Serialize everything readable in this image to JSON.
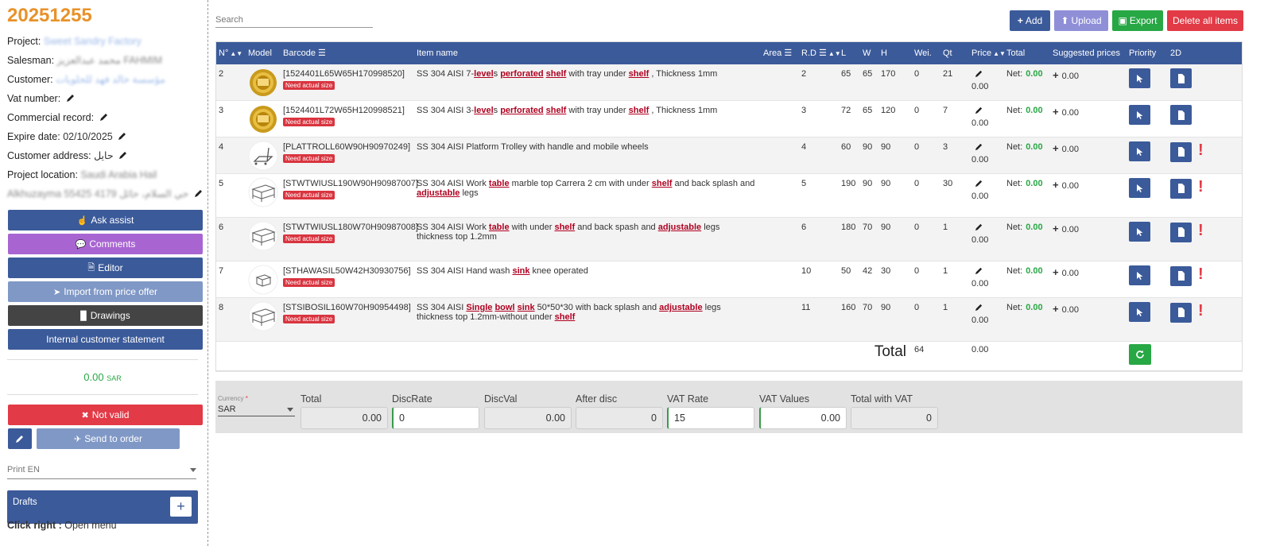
{
  "quote_number": "20251255",
  "info": {
    "project_label": "Project:",
    "project_value": "Sweet Sandry Factory",
    "salesman_label": "Salesman:",
    "salesman_value": "محمد عبدالعزيز FAHMIM",
    "customer_label": "Customer:",
    "customer_value": "مؤسسة خالد فهد للحلويات",
    "vat_label": "Vat number:",
    "commercial_label": "Commercial record:",
    "expire_label": "Expire date:",
    "expire_value": "02/10/2025",
    "address_label": "Customer address:",
    "address_value": "حايل",
    "location_label": "Project location:",
    "location_value": "Saudi Arabia Hail",
    "location_value_2": "Alkhuzayma 55425 4179 حي السلام، حائل"
  },
  "buttons": {
    "ask_assist": "Ask assist",
    "comments": "Comments",
    "editor": "Editor",
    "import_offer": "Import from price offer",
    "drawings": "Drawings",
    "internal_statement": "Internal customer statement",
    "not_valid": "Not valid",
    "send_to_order": "Send to order"
  },
  "amount": {
    "value": "0.00",
    "currency": "SAR"
  },
  "print_select": "Print EN",
  "drafts_label": "Drafts",
  "footer": {
    "bold": "Click right :",
    "text": " Open menu"
  },
  "toolbar": {
    "search_placeholder": "Search",
    "add": "Add",
    "upload": "Upload",
    "export": "Export",
    "delete_all": "Delete all items"
  },
  "columns": [
    "N°",
    "Model",
    "Barcode",
    "Item name",
    "Area",
    "R.D",
    "L",
    "W",
    "H",
    "Wei.",
    "Qt",
    "Price",
    "Total",
    "Suggested prices",
    "Priority",
    "2D"
  ],
  "rows": [
    {
      "n": "2",
      "barcode": "[1524401L65W65H170998520]",
      "need": "Need actual size",
      "name": [
        {
          "t": "SS 304 AISI 7-"
        },
        {
          "t": "level",
          "k": 1
        },
        {
          "t": "s "
        },
        {
          "t": "perforated",
          "k": 1
        },
        {
          "t": " "
        },
        {
          "t": "shelf",
          "k": 1
        },
        {
          "t": " with tray under "
        },
        {
          "t": "shelf",
          "k": 1
        },
        {
          "t": " , Thickness 1mm"
        }
      ],
      "rd": "2",
      "l": "65",
      "w": "65",
      "h": "170",
      "wei": "0",
      "qt": "21",
      "price": "0.00",
      "net_label": "Net:",
      "net": "0.00",
      "suggested": "0.00",
      "warn": false,
      "model": "medal"
    },
    {
      "n": "3",
      "barcode": "[1524401L72W65H120998521]",
      "need": "Need actual size",
      "name": [
        {
          "t": "SS 304 AISI 3-"
        },
        {
          "t": "level",
          "k": 1
        },
        {
          "t": "s "
        },
        {
          "t": "perforated",
          "k": 1
        },
        {
          "t": " "
        },
        {
          "t": "shelf",
          "k": 1
        },
        {
          "t": " with tray under "
        },
        {
          "t": "shelf",
          "k": 1
        },
        {
          "t": " , Thickness 1mm"
        }
      ],
      "rd": "3",
      "l": "72",
      "w": "65",
      "h": "120",
      "wei": "0",
      "qt": "7",
      "price": "0.00",
      "net_label": "Net:",
      "net": "0.00",
      "suggested": "0.00",
      "warn": false,
      "model": "medal"
    },
    {
      "n": "4",
      "barcode": "[PLATTROLL60W90H90970249]",
      "need": "Need actual size",
      "name": [
        {
          "t": "SS 304 AISI Platform Trolley with handle and mobile wheels"
        }
      ],
      "rd": "4",
      "l": "60",
      "w": "90",
      "h": "90",
      "wei": "0",
      "qt": "3",
      "price": "0.00",
      "net_label": "Net:",
      "net": "0.00",
      "suggested": "0.00",
      "warn": true,
      "model": "trolley"
    },
    {
      "n": "5",
      "barcode": "[STWTWIUSL190W90H90987007]",
      "need": "Need actual size",
      "name": [
        {
          "t": "SS 304 AISI Work "
        },
        {
          "t": "table",
          "k": 1
        },
        {
          "t": " marble top Carrera 2 cm with under "
        },
        {
          "t": "shelf",
          "k": 1
        },
        {
          "t": " and back splash and "
        },
        {
          "t": "adjustable",
          "k": 1
        },
        {
          "t": " legs"
        }
      ],
      "rd": "5",
      "l": "190",
      "w": "90",
      "h": "90",
      "wei": "0",
      "qt": "30",
      "price": "0.00",
      "net_label": "Net:",
      "net": "0.00",
      "suggested": "0.00",
      "warn": true,
      "model": "table"
    },
    {
      "n": "6",
      "barcode": "[STWTWIUSL180W70H90987008]",
      "need": "Need actual size",
      "name": [
        {
          "t": "SS 304 AISI Work "
        },
        {
          "t": "table",
          "k": 1
        },
        {
          "t": " with under "
        },
        {
          "t": "shelf",
          "k": 1
        },
        {
          "t": " and back spash and "
        },
        {
          "t": "adjustable",
          "k": 1
        },
        {
          "t": " legs thickness top 1.2mm"
        }
      ],
      "rd": "6",
      "l": "180",
      "w": "70",
      "h": "90",
      "wei": "0",
      "qt": "1",
      "price": "0.00",
      "net_label": "Net:",
      "net": "0.00",
      "suggested": "0.00",
      "warn": true,
      "model": "table"
    },
    {
      "n": "7",
      "barcode": "[STHAWASIL50W42H30930756]",
      "need": "Need actual size",
      "name": [
        {
          "t": "SS 304 AISI Hand wash "
        },
        {
          "t": "sink",
          "k": 1
        },
        {
          "t": " knee operated"
        }
      ],
      "rd": "10",
      "l": "50",
      "w": "42",
      "h": "30",
      "wei": "0",
      "qt": "1",
      "price": "0.00",
      "net_label": "Net:",
      "net": "0.00",
      "suggested": "0.00",
      "warn": true,
      "model": "sink"
    },
    {
      "n": "8",
      "barcode": "[STSIBOSIL160W70H90954498]",
      "need": "Need actual size",
      "name": [
        {
          "t": "SS 304 AISI "
        },
        {
          "t": "Single",
          "k": 1
        },
        {
          "t": " "
        },
        {
          "t": "bowl",
          "k": 1
        },
        {
          "t": " "
        },
        {
          "t": "sink",
          "k": 1
        },
        {
          "t": " 50*50*30 with back splash and "
        },
        {
          "t": "adjustable",
          "k": 1
        },
        {
          "t": " legs thickness top 1.2mm-without under "
        },
        {
          "t": "shelf",
          "k": 1
        }
      ],
      "rd": "11",
      "l": "160",
      "w": "70",
      "h": "90",
      "wei": "0",
      "qt": "1",
      "price": "0.00",
      "net_label": "Net:",
      "net": "0.00",
      "suggested": "0.00",
      "warn": true,
      "model": "table"
    }
  ],
  "table_total": {
    "label": "Total",
    "qty": "64",
    "value": "0.00"
  },
  "totals": {
    "currency_label": "Currency",
    "currency_required": "*",
    "currency_value": "SAR",
    "fields": [
      {
        "label": "Total",
        "value": "0.00",
        "mode": "ro"
      },
      {
        "label": "DiscRate",
        "value": "0",
        "mode": "rw"
      },
      {
        "label": "DiscVal",
        "value": "0.00",
        "mode": "ro"
      },
      {
        "label": "After disc",
        "value": "0",
        "mode": "ro"
      },
      {
        "label": "VAT Rate",
        "value": "15",
        "mode": "rw"
      },
      {
        "label": "VAT Values",
        "value": "0.00",
        "mode": "rwr"
      },
      {
        "label": "Total with VAT",
        "value": "0",
        "mode": "ro"
      }
    ]
  }
}
